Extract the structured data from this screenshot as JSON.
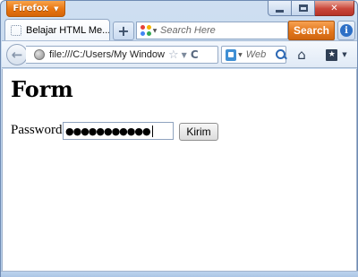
{
  "browser": {
    "app_menu_label": "Firefox",
    "colors": {
      "accent": "#e87510",
      "frame": "#bcd3ee"
    }
  },
  "window_controls": {
    "minimize_icon": "minimize-icon",
    "maximize_icon": "maximize-icon",
    "close_icon": "close-icon",
    "close_glyph": "✕"
  },
  "tabs": [
    {
      "label": "Belajar HTML Me...",
      "icon": "page-icon",
      "active": true
    }
  ],
  "new_tab": {
    "glyph": "+"
  },
  "search": {
    "placeholder": "Search Here",
    "button_label": "Search",
    "info_glyph": "i"
  },
  "navigation": {
    "back_glyph": "←",
    "url": "file:///C:/Users/My Window",
    "star_glyph": "☆",
    "dropdown_glyph": "▼",
    "reload_glyph": "C",
    "web_search_placeholder": "Web",
    "home_glyph": "⌂",
    "bookmarks_glyph": "★",
    "bookmarks_caret": "▼"
  },
  "page": {
    "title": "Form",
    "password_label": "Password",
    "password_masked": "●●●●●●●●●●●",
    "submit_label": "Kirim"
  }
}
